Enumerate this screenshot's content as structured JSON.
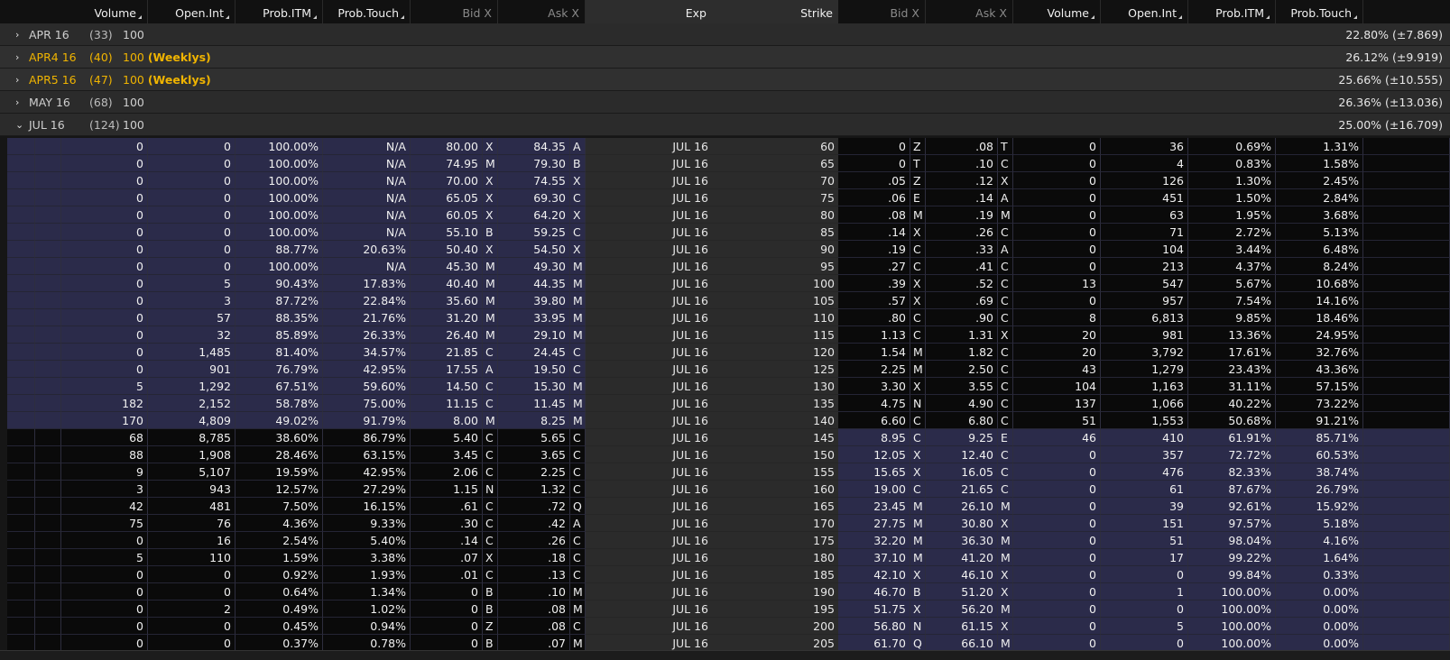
{
  "header": {
    "columns_left": [
      "Volume",
      "Open.Int",
      "Prob.ITM",
      "Prob.Touch",
      "Bid X",
      "Ask X"
    ],
    "exp": "Exp",
    "strike": "Strike",
    "columns_right": [
      "Bid X",
      "Ask X",
      "Volume",
      "Open.Int",
      "Prob.ITM",
      "Prob.Touch"
    ]
  },
  "series": [
    {
      "name": "APR 16",
      "count": "(33)",
      "mult": "100",
      "weekly": "",
      "iv": "22.80% (±7.869)",
      "expanded": false
    },
    {
      "name": "APR4 16",
      "count": "(40)",
      "mult": "100",
      "weekly": "(Weeklys)",
      "iv": "26.12% (±9.919)",
      "expanded": false
    },
    {
      "name": "APR5 16",
      "count": "(47)",
      "mult": "100",
      "weekly": "(Weeklys)",
      "iv": "25.66% (±10.555)",
      "expanded": false
    },
    {
      "name": "MAY 16",
      "count": "(68)",
      "mult": "100",
      "weekly": "",
      "iv": "26.36% (±13.036)",
      "expanded": false
    },
    {
      "name": "JUL 16",
      "count": "(124)",
      "mult": "100",
      "weekly": "",
      "iv": "25.00% (±16.709)",
      "expanded": true
    }
  ],
  "rows": [
    {
      "cv": "0",
      "coi": "0",
      "citm": "100.00%",
      "ctch": "N/A",
      "cbid": "80.00",
      "cbx": "X",
      "cask": "84.35",
      "cax": "A",
      "exp": "JUL 16",
      "strike": "60",
      "pbid": "0",
      "pbx": "Z",
      "pask": ".08",
      "pax": "T",
      "pv": "0",
      "poi": "36",
      "pitm": "0.69%",
      "ptch": "1.31%"
    },
    {
      "cv": "0",
      "coi": "0",
      "citm": "100.00%",
      "ctch": "N/A",
      "cbid": "74.95",
      "cbx": "M",
      "cask": "79.30",
      "cax": "B",
      "exp": "JUL 16",
      "strike": "65",
      "pbid": "0",
      "pbx": "T",
      "pask": ".10",
      "pax": "C",
      "pv": "0",
      "poi": "4",
      "pitm": "0.83%",
      "ptch": "1.58%"
    },
    {
      "cv": "0",
      "coi": "0",
      "citm": "100.00%",
      "ctch": "N/A",
      "cbid": "70.00",
      "cbx": "X",
      "cask": "74.55",
      "cax": "X",
      "exp": "JUL 16",
      "strike": "70",
      "pbid": ".05",
      "pbx": "Z",
      "pask": ".12",
      "pax": "X",
      "pv": "0",
      "poi": "126",
      "pitm": "1.30%",
      "ptch": "2.45%"
    },
    {
      "cv": "0",
      "coi": "0",
      "citm": "100.00%",
      "ctch": "N/A",
      "cbid": "65.05",
      "cbx": "X",
      "cask": "69.30",
      "cax": "C",
      "exp": "JUL 16",
      "strike": "75",
      "pbid": ".06",
      "pbx": "E",
      "pask": ".14",
      "pax": "A",
      "pv": "0",
      "poi": "451",
      "pitm": "1.50%",
      "ptch": "2.84%"
    },
    {
      "cv": "0",
      "coi": "0",
      "citm": "100.00%",
      "ctch": "N/A",
      "cbid": "60.05",
      "cbx": "X",
      "cask": "64.20",
      "cax": "X",
      "exp": "JUL 16",
      "strike": "80",
      "pbid": ".08",
      "pbx": "M",
      "pask": ".19",
      "pax": "M",
      "pv": "0",
      "poi": "63",
      "pitm": "1.95%",
      "ptch": "3.68%"
    },
    {
      "cv": "0",
      "coi": "0",
      "citm": "100.00%",
      "ctch": "N/A",
      "cbid": "55.10",
      "cbx": "B",
      "cask": "59.25",
      "cax": "C",
      "exp": "JUL 16",
      "strike": "85",
      "pbid": ".14",
      "pbx": "X",
      "pask": ".26",
      "pax": "C",
      "pv": "0",
      "poi": "71",
      "pitm": "2.72%",
      "ptch": "5.13%"
    },
    {
      "cv": "0",
      "coi": "0",
      "citm": "88.77%",
      "ctch": "20.63%",
      "cbid": "50.40",
      "cbx": "X",
      "cask": "54.50",
      "cax": "X",
      "exp": "JUL 16",
      "strike": "90",
      "pbid": ".19",
      "pbx": "C",
      "pask": ".33",
      "pax": "A",
      "pv": "0",
      "poi": "104",
      "pitm": "3.44%",
      "ptch": "6.48%"
    },
    {
      "cv": "0",
      "coi": "0",
      "citm": "100.00%",
      "ctch": "N/A",
      "cbid": "45.30",
      "cbx": "M",
      "cask": "49.30",
      "cax": "M",
      "exp": "JUL 16",
      "strike": "95",
      "pbid": ".27",
      "pbx": "C",
      "pask": ".41",
      "pax": "C",
      "pv": "0",
      "poi": "213",
      "pitm": "4.37%",
      "ptch": "8.24%"
    },
    {
      "cv": "0",
      "coi": "5",
      "citm": "90.43%",
      "ctch": "17.83%",
      "cbid": "40.40",
      "cbx": "M",
      "cask": "44.35",
      "cax": "M",
      "exp": "JUL 16",
      "strike": "100",
      "pbid": ".39",
      "pbx": "X",
      "pask": ".52",
      "pax": "C",
      "pv": "13",
      "poi": "547",
      "pitm": "5.67%",
      "ptch": "10.68%"
    },
    {
      "cv": "0",
      "coi": "3",
      "citm": "87.72%",
      "ctch": "22.84%",
      "cbid": "35.60",
      "cbx": "M",
      "cask": "39.80",
      "cax": "M",
      "exp": "JUL 16",
      "strike": "105",
      "pbid": ".57",
      "pbx": "X",
      "pask": ".69",
      "pax": "C",
      "pv": "0",
      "poi": "957",
      "pitm": "7.54%",
      "ptch": "14.16%"
    },
    {
      "cv": "0",
      "coi": "57",
      "citm": "88.35%",
      "ctch": "21.76%",
      "cbid": "31.20",
      "cbx": "M",
      "cask": "33.95",
      "cax": "M",
      "exp": "JUL 16",
      "strike": "110",
      "pbid": ".80",
      "pbx": "C",
      "pask": ".90",
      "pax": "C",
      "pv": "8",
      "poi": "6,813",
      "pitm": "9.85%",
      "ptch": "18.46%"
    },
    {
      "cv": "0",
      "coi": "32",
      "citm": "85.89%",
      "ctch": "26.33%",
      "cbid": "26.40",
      "cbx": "M",
      "cask": "29.10",
      "cax": "M",
      "exp": "JUL 16",
      "strike": "115",
      "pbid": "1.13",
      "pbx": "C",
      "pask": "1.31",
      "pax": "X",
      "pv": "20",
      "poi": "981",
      "pitm": "13.36%",
      "ptch": "24.95%"
    },
    {
      "cv": "0",
      "coi": "1,485",
      "citm": "81.40%",
      "ctch": "34.57%",
      "cbid": "21.85",
      "cbx": "C",
      "cask": "24.45",
      "cax": "C",
      "exp": "JUL 16",
      "strike": "120",
      "pbid": "1.54",
      "pbx": "M",
      "pask": "1.82",
      "pax": "C",
      "pv": "20",
      "poi": "3,792",
      "pitm": "17.61%",
      "ptch": "32.76%"
    },
    {
      "cv": "0",
      "coi": "901",
      "citm": "76.79%",
      "ctch": "42.95%",
      "cbid": "17.55",
      "cbx": "A",
      "cask": "19.50",
      "cax": "C",
      "exp": "JUL 16",
      "strike": "125",
      "pbid": "2.25",
      "pbx": "M",
      "pask": "2.50",
      "pax": "C",
      "pv": "43",
      "poi": "1,279",
      "pitm": "23.43%",
      "ptch": "43.36%"
    },
    {
      "cv": "5",
      "coi": "1,292",
      "citm": "67.51%",
      "ctch": "59.60%",
      "cbid": "14.50",
      "cbx": "C",
      "cask": "15.30",
      "cax": "M",
      "exp": "JUL 16",
      "strike": "130",
      "pbid": "3.30",
      "pbx": "X",
      "pask": "3.55",
      "pax": "C",
      "pv": "104",
      "poi": "1,163",
      "pitm": "31.11%",
      "ptch": "57.15%"
    },
    {
      "cv": "182",
      "coi": "2,152",
      "citm": "58.78%",
      "ctch": "75.00%",
      "cbid": "11.15",
      "cbx": "C",
      "cask": "11.45",
      "cax": "M",
      "exp": "JUL 16",
      "strike": "135",
      "pbid": "4.75",
      "pbx": "N",
      "pask": "4.90",
      "pax": "C",
      "pv": "137",
      "poi": "1,066",
      "pitm": "40.22%",
      "ptch": "73.22%"
    },
    {
      "cv": "170",
      "coi": "4,809",
      "citm": "49.02%",
      "ctch": "91.79%",
      "cbid": "8.00",
      "cbx": "M",
      "cask": "8.25",
      "cax": "M",
      "exp": "JUL 16",
      "strike": "140",
      "pbid": "6.60",
      "pbx": "C",
      "pask": "6.80",
      "pax": "C",
      "pv": "51",
      "poi": "1,553",
      "pitm": "50.68%",
      "ptch": "91.21%"
    },
    {
      "cv": "68",
      "coi": "8,785",
      "citm": "38.60%",
      "ctch": "86.79%",
      "cbid": "5.40",
      "cbx": "C",
      "cask": "5.65",
      "cax": "C",
      "exp": "JUL 16",
      "strike": "145",
      "pbid": "8.95",
      "pbx": "C",
      "pask": "9.25",
      "pax": "E",
      "pv": "46",
      "poi": "410",
      "pitm": "61.91%",
      "ptch": "85.71%"
    },
    {
      "cv": "88",
      "coi": "1,908",
      "citm": "28.46%",
      "ctch": "63.15%",
      "cbid": "3.45",
      "cbx": "C",
      "cask": "3.65",
      "cax": "C",
      "exp": "JUL 16",
      "strike": "150",
      "pbid": "12.05",
      "pbx": "X",
      "pask": "12.40",
      "pax": "C",
      "pv": "0",
      "poi": "357",
      "pitm": "72.72%",
      "ptch": "60.53%"
    },
    {
      "cv": "9",
      "coi": "5,107",
      "citm": "19.59%",
      "ctch": "42.95%",
      "cbid": "2.06",
      "cbx": "C",
      "cask": "2.25",
      "cax": "C",
      "exp": "JUL 16",
      "strike": "155",
      "pbid": "15.65",
      "pbx": "X",
      "pask": "16.05",
      "pax": "C",
      "pv": "0",
      "poi": "476",
      "pitm": "82.33%",
      "ptch": "38.74%"
    },
    {
      "cv": "3",
      "coi": "943",
      "citm": "12.57%",
      "ctch": "27.29%",
      "cbid": "1.15",
      "cbx": "N",
      "cask": "1.32",
      "cax": "C",
      "exp": "JUL 16",
      "strike": "160",
      "pbid": "19.00",
      "pbx": "C",
      "pask": "21.65",
      "pax": "C",
      "pv": "0",
      "poi": "61",
      "pitm": "87.67%",
      "ptch": "26.79%"
    },
    {
      "cv": "42",
      "coi": "481",
      "citm": "7.50%",
      "ctch": "16.15%",
      "cbid": ".61",
      "cbx": "C",
      "cask": ".72",
      "cax": "Q",
      "exp": "JUL 16",
      "strike": "165",
      "pbid": "23.45",
      "pbx": "M",
      "pask": "26.10",
      "pax": "M",
      "pv": "0",
      "poi": "39",
      "pitm": "92.61%",
      "ptch": "15.92%"
    },
    {
      "cv": "75",
      "coi": "76",
      "citm": "4.36%",
      "ctch": "9.33%",
      "cbid": ".30",
      "cbx": "C",
      "cask": ".42",
      "cax": "A",
      "exp": "JUL 16",
      "strike": "170",
      "pbid": "27.75",
      "pbx": "M",
      "pask": "30.80",
      "pax": "X",
      "pv": "0",
      "poi": "151",
      "pitm": "97.57%",
      "ptch": "5.18%"
    },
    {
      "cv": "0",
      "coi": "16",
      "citm": "2.54%",
      "ctch": "5.40%",
      "cbid": ".14",
      "cbx": "C",
      "cask": ".26",
      "cax": "C",
      "exp": "JUL 16",
      "strike": "175",
      "pbid": "32.20",
      "pbx": "M",
      "pask": "36.30",
      "pax": "M",
      "pv": "0",
      "poi": "51",
      "pitm": "98.04%",
      "ptch": "4.16%"
    },
    {
      "cv": "5",
      "coi": "110",
      "citm": "1.59%",
      "ctch": "3.38%",
      "cbid": ".07",
      "cbx": "X",
      "cask": ".18",
      "cax": "C",
      "exp": "JUL 16",
      "strike": "180",
      "pbid": "37.10",
      "pbx": "M",
      "pask": "41.20",
      "pax": "M",
      "pv": "0",
      "poi": "17",
      "pitm": "99.22%",
      "ptch": "1.64%"
    },
    {
      "cv": "0",
      "coi": "0",
      "citm": "0.92%",
      "ctch": "1.93%",
      "cbid": ".01",
      "cbx": "C",
      "cask": ".13",
      "cax": "C",
      "exp": "JUL 16",
      "strike": "185",
      "pbid": "42.10",
      "pbx": "X",
      "pask": "46.10",
      "pax": "X",
      "pv": "0",
      "poi": "0",
      "pitm": "99.84%",
      "ptch": "0.33%"
    },
    {
      "cv": "0",
      "coi": "0",
      "citm": "0.64%",
      "ctch": "1.34%",
      "cbid": "0",
      "cbx": "B",
      "cask": ".10",
      "cax": "M",
      "exp": "JUL 16",
      "strike": "190",
      "pbid": "46.70",
      "pbx": "B",
      "pask": "51.20",
      "pax": "X",
      "pv": "0",
      "poi": "1",
      "pitm": "100.00%",
      "ptch": "0.00%"
    },
    {
      "cv": "0",
      "coi": "2",
      "citm": "0.49%",
      "ctch": "1.02%",
      "cbid": "0",
      "cbx": "B",
      "cask": ".08",
      "cax": "M",
      "exp": "JUL 16",
      "strike": "195",
      "pbid": "51.75",
      "pbx": "X",
      "pask": "56.20",
      "pax": "M",
      "pv": "0",
      "poi": "0",
      "pitm": "100.00%",
      "ptch": "0.00%"
    },
    {
      "cv": "0",
      "coi": "0",
      "citm": "0.45%",
      "ctch": "0.94%",
      "cbid": "0",
      "cbx": "Z",
      "cask": ".08",
      "cax": "C",
      "exp": "JUL 16",
      "strike": "200",
      "pbid": "56.80",
      "pbx": "N",
      "pask": "61.15",
      "pax": "X",
      "pv": "0",
      "poi": "5",
      "pitm": "100.00%",
      "ptch": "0.00%"
    },
    {
      "cv": "0",
      "coi": "0",
      "citm": "0.37%",
      "ctch": "0.78%",
      "cbid": "0",
      "cbx": "B",
      "cask": ".07",
      "cax": "M",
      "exp": "JUL 16",
      "strike": "205",
      "pbid": "61.70",
      "pbx": "Q",
      "pask": "66.10",
      "pax": "M",
      "pv": "0",
      "poi": "0",
      "pitm": "100.00%",
      "ptch": "0.00%"
    }
  ],
  "colors": {
    "itm": "#2b2b4a",
    "otm": "#0a0a0a",
    "weekly": "#f0b400"
  }
}
